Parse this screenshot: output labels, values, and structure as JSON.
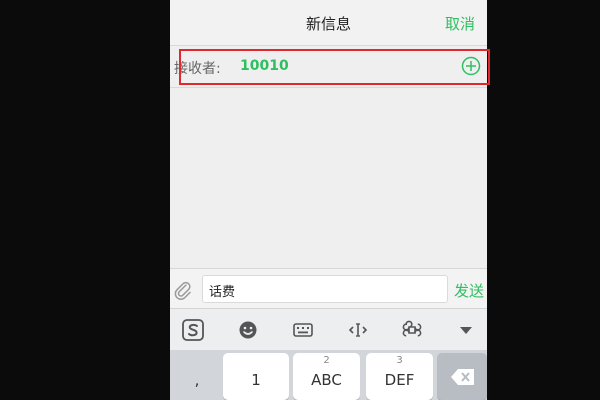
{
  "header": {
    "title": "新信息",
    "cancel_label": "取消"
  },
  "recipient": {
    "label": "接收者:",
    "value": "10010",
    "add_icon": "plus-circle-icon"
  },
  "compose": {
    "attach_icon": "paperclip-icon",
    "message_value": "话费",
    "send_label": "发送"
  },
  "keyboard_toolbar": {
    "icons": [
      "sogou-logo-icon",
      "emoji-icon",
      "keyboard-icon",
      "cursor-move-icon",
      "command-icon",
      "collapse-keyboard-icon"
    ]
  },
  "keyboard": {
    "keys": [
      {
        "num": "",
        "label": ","
      },
      {
        "num": "",
        "label": "1"
      },
      {
        "num": "2",
        "label": "ABC"
      },
      {
        "num": "3",
        "label": "DEF"
      }
    ],
    "delete_icon": "backspace-icon"
  },
  "colors": {
    "accent": "#2fbf61",
    "highlight": "#e0282e",
    "background": "#0b0b0b"
  }
}
